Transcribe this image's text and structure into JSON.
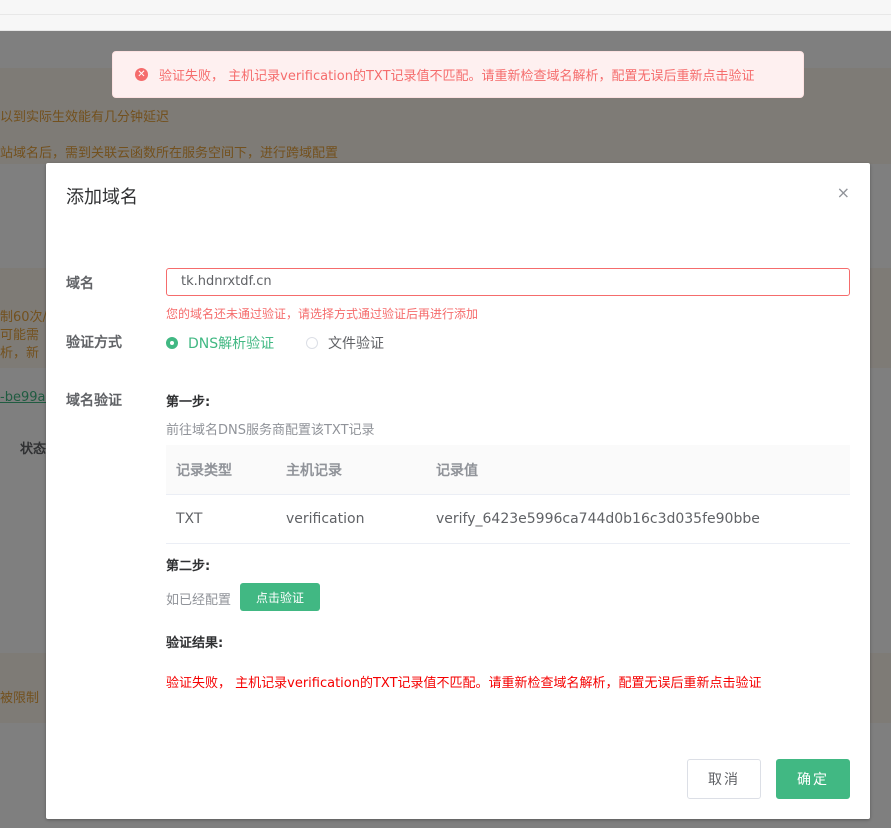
{
  "toast": {
    "icon": "error-circle-icon",
    "message": "验证失败， 主机记录verification的TXT记录值不匹配。请重新检查域名解析，配置无误后重新点击验证"
  },
  "background": {
    "line1": "以到实际生效能有几分钟延迟",
    "line2": "站域名后，需到关联云函数所在服务空间下，进行跨域配置",
    "line3": "制60次/",
    "line4": "可能需",
    "line5": "析，新",
    "link": "-be99a9",
    "col_status": "状态",
    "line6": "被限制"
  },
  "dialog": {
    "title": "添加域名",
    "close": "×",
    "domain_label": "域名",
    "domain_value": "tk.hdnrxtdf.cn",
    "domain_error": "您的域名还未通过验证，请选择方式通过验证后再进行添加",
    "method_label": "验证方式",
    "method_options": [
      {
        "label": "DNS解析验证",
        "selected": true
      },
      {
        "label": "文件验证",
        "selected": false
      }
    ],
    "verify_label": "域名验证",
    "step1_title": "第一步:",
    "step1_desc": "前往域名DNS服务商配置该TXT记录",
    "table": {
      "headers": [
        "记录类型",
        "主机记录",
        "记录值"
      ],
      "rows": [
        [
          "TXT",
          "verification",
          "verify_6423e5996ca744d0b16c3d035fe90bbe"
        ]
      ]
    },
    "step2_title": "第二步:",
    "step2_desc": "如已经配置",
    "verify_button": "点击验证",
    "result_title": "验证结果:",
    "result_message": "验证失败， 主机记录verification的TXT记录值不匹配。请重新检查域名解析，配置无误后重新点击验证",
    "cancel_button": "取消",
    "ok_button": "确定"
  },
  "colors": {
    "accent": "#41b883",
    "error": "#f56c6c",
    "result_error": "#f50000",
    "warning_bg": "#fdf6ec"
  }
}
